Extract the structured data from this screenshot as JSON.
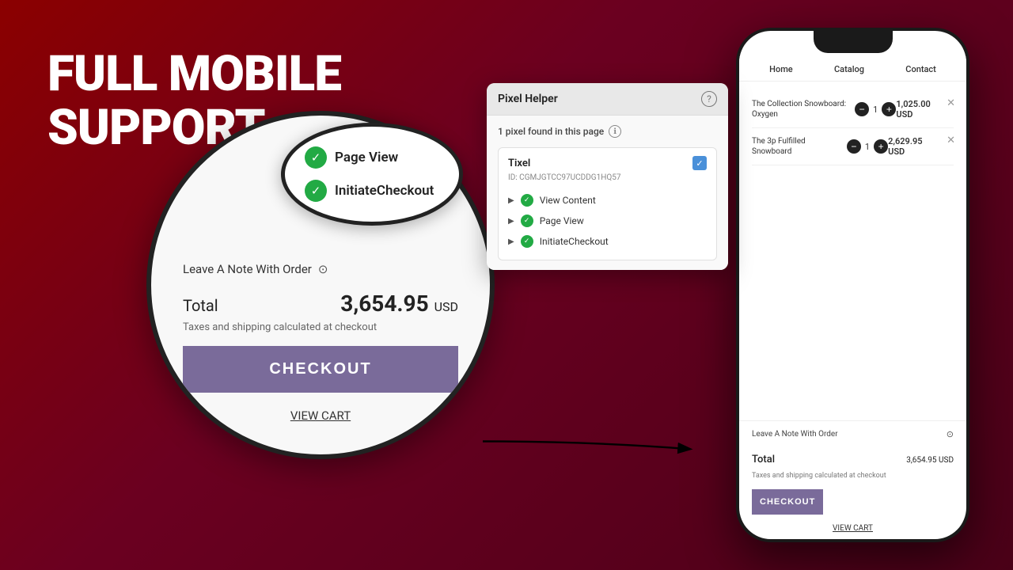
{
  "hero": {
    "line1": "FULL MOBILE",
    "line2": "SUPPORT"
  },
  "phone": {
    "nav": [
      "Home",
      "Catalog",
      "Contact"
    ],
    "cart_items": [
      {
        "name": "The Collection Snowboard: Oxygen",
        "qty": 1,
        "price": "1,025.00 USD"
      },
      {
        "name": "The 3p Fulfilled Snowboard",
        "qty": 1,
        "price": "2,629.95 USD"
      }
    ],
    "note_label": "Leave A Note With Order",
    "total_label": "Total",
    "total_amount": "3,654.95",
    "total_currency": "USD",
    "taxes_text": "Taxes and shipping calculated at checkout",
    "checkout_btn": "CHECKOUT",
    "viewcart_btn": "VIEW CART"
  },
  "circle": {
    "note_label": "Leave A Note With Order",
    "total_label": "Total",
    "total_amount": "3,654.95",
    "total_currency": "USD",
    "taxes_text": "Taxes and shipping calculated at checkout",
    "checkout_btn": "CHECKOUT",
    "viewcart_btn": "VIEW CART"
  },
  "bubble": {
    "items": [
      {
        "label": "Page View"
      },
      {
        "label": "InitiateCheckout"
      }
    ]
  },
  "pixel_panel": {
    "title": "Pixel Helper",
    "help_icon": "?",
    "found_text": "1 pixel found in this page",
    "tixel_name": "Tixel",
    "tixel_id": "ID: CGMJGTCC97UCDDG1HQ57",
    "events": [
      {
        "label": "View Content"
      },
      {
        "label": "Page View"
      },
      {
        "label": "InitiateCheckout"
      }
    ]
  },
  "colors": {
    "background_start": "#8b0000",
    "background_end": "#4a0018",
    "checkout_btn": "#7a6b9a",
    "check_green": "#22aa44"
  }
}
